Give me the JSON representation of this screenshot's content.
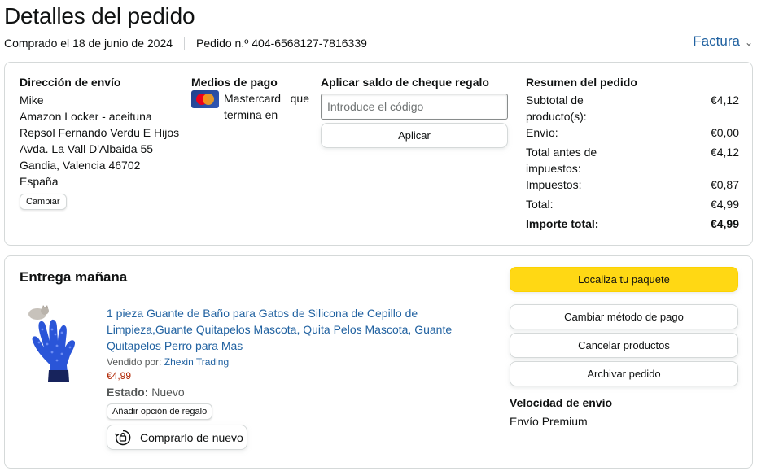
{
  "header": {
    "title": "Detalles del pedido",
    "purchased": "Comprado el 18 de junio de 2024",
    "order_number": "Pedido n.º 404-6568127-7816339",
    "invoice_label": "Factura"
  },
  "shipping": {
    "title": "Dirección de envío",
    "lines": [
      "Mike",
      "Amazon Locker - aceituna",
      "Repsol Fernando Verdu E Hijos",
      "Avda. La Vall D'Albaida 55",
      "Gandia, Valencia 46702",
      "España"
    ],
    "change_label": "Cambiar"
  },
  "payment": {
    "title": "Medios de pago",
    "card_text": "Mastercard que termina en"
  },
  "gift_card": {
    "title": "Aplicar saldo de cheque regalo",
    "placeholder": "Introduce el código",
    "apply_label": "Aplicar"
  },
  "summary": {
    "title": "Resumen del pedido",
    "rows": [
      {
        "label": "Subtotal de producto(s):",
        "value": "€4,12"
      },
      {
        "label": "Envío:",
        "value": "€0,00"
      },
      {
        "label": "Total antes de impuestos:",
        "value": "€4,12"
      },
      {
        "label": "Impuestos:",
        "value": "€0,87"
      },
      {
        "label": "Total:",
        "value": "€4,99"
      },
      {
        "label": "Importe total:",
        "value": "€4,99"
      }
    ]
  },
  "delivery": {
    "title": "Entrega mañana",
    "product_title": "1 pieza Guante de Baño para Gatos de Silicona de Cepillo de Limpieza,Guante Quitapelos Mascota, Quita Pelos Mascota, Guante Quitapelos Perro para Mas",
    "sold_by_label": "Vendido por:",
    "seller": "Zhexin Trading",
    "price": "€4,99",
    "state_label": "Estado:",
    "state_value": "Nuevo",
    "gift_option_label": "Añadir opción de regalo",
    "rebuy_label": "Comprarlo de nuevo"
  },
  "actions": {
    "track_label": "Localiza tu paquete",
    "change_payment_label": "Cambiar método de pago",
    "cancel_label": "Cancelar productos",
    "archive_label": "Archivar pedido",
    "speed_title": "Velocidad de envío",
    "speed_value": "Envío Premium"
  },
  "colors": {
    "link": "#2162a1",
    "price": "#b12704",
    "primary_button": "#ffd814",
    "border": "#d5d9d9"
  }
}
